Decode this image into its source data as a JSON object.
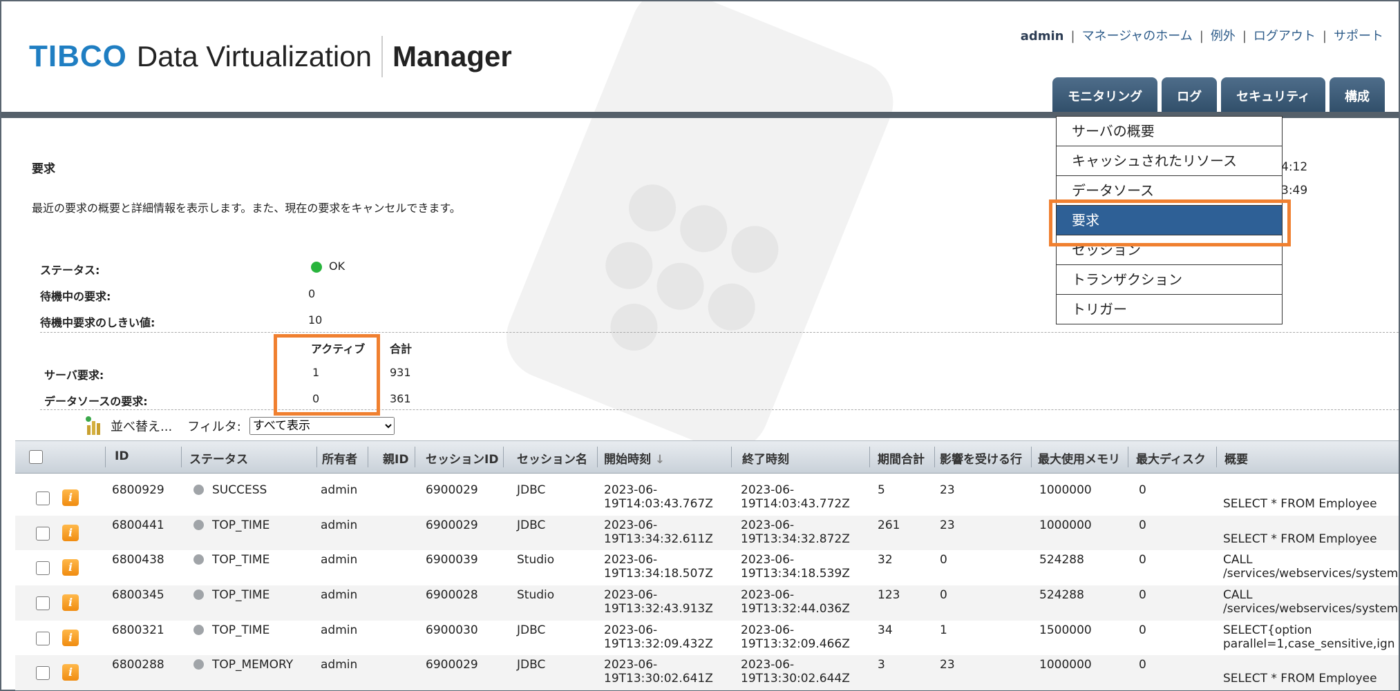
{
  "app": {
    "brand": "TIBCO",
    "product": "Data Virtualization",
    "module": "Manager"
  },
  "top_links": {
    "user": "admin",
    "home": "マネージャのホーム",
    "exceptions": "例外",
    "logout": "ログアウト",
    "support": "サポート"
  },
  "tabs": [
    "モニタリング",
    "ログ",
    "セキュリティ",
    "構成"
  ],
  "menu": {
    "items": [
      "サーバの概要",
      "キャッシュされたリソース",
      "データソース",
      "要求",
      "セッション",
      "トランザクション",
      "トリガー"
    ],
    "selected": "要求",
    "selected_index": 3
  },
  "peek_text": [
    "4:12",
    "3:49"
  ],
  "page": {
    "title": "要求",
    "description": "最近の要求の概要と詳細情報を表示します。また、現在の要求をキャンセルできます。"
  },
  "status": {
    "status_label": "ステータス:",
    "status_value": "OK",
    "pending_label": "待機中の要求:",
    "pending_value": "0",
    "threshold_label": "待機中要求のしきい値:",
    "threshold_value": "10",
    "col_active": "アクティブ",
    "col_total": "合計",
    "server_label": "サーバ要求:",
    "server_active": "1",
    "server_total": "931",
    "ds_label": "データソースの要求:",
    "ds_active": "0",
    "ds_total": "361"
  },
  "toolbar": {
    "sort_label": "並べ替え...",
    "filter_label": "フィルタ:",
    "filter_value": "すべて表示"
  },
  "table": {
    "headers": [
      "ID",
      "ステータス",
      "所有者",
      "親ID",
      "セッションID",
      "セッション名",
      "開始時刻",
      "終了時刻",
      "期間合計",
      "影響を受ける行",
      "最大使用メモリ",
      "最大ディスク",
      "概要"
    ],
    "sort_indicator": "↓",
    "rows": [
      {
        "id": "6800929",
        "status": "SUCCESS",
        "owner": "admin",
        "session_id": "6900029",
        "session_name": "JDBC",
        "start": [
          "2023-06-",
          "19T14:03:43.767Z"
        ],
        "end": [
          "2023-06-",
          "19T14:03:43.772Z"
        ],
        "duration": "5",
        "rows": "23",
        "mem": "1000000",
        "disk": "0",
        "summary": [
          "",
          "SELECT * FROM Employee"
        ]
      },
      {
        "id": "6800441",
        "status": "TOP_TIME",
        "owner": "admin",
        "session_id": "6900029",
        "session_name": "JDBC",
        "start": [
          "2023-06-",
          "19T13:34:32.611Z"
        ],
        "end": [
          "2023-06-",
          "19T13:34:32.872Z"
        ],
        "duration": "261",
        "rows": "23",
        "mem": "1000000",
        "disk": "0",
        "summary": [
          "",
          "SELECT * FROM Employee"
        ]
      },
      {
        "id": "6800438",
        "status": "TOP_TIME",
        "owner": "admin",
        "session_id": "6900039",
        "session_name": "Studio",
        "start": [
          "2023-06-",
          "19T13:34:18.507Z"
        ],
        "end": [
          "2023-06-",
          "19T13:34:18.539Z"
        ],
        "duration": "32",
        "rows": "0",
        "mem": "524288",
        "disk": "0",
        "summary": [
          "CALL",
          "/services/webservices/system"
        ]
      },
      {
        "id": "6800345",
        "status": "TOP_TIME",
        "owner": "admin",
        "session_id": "6900028",
        "session_name": "Studio",
        "start": [
          "2023-06-",
          "19T13:32:43.913Z"
        ],
        "end": [
          "2023-06-",
          "19T13:32:44.036Z"
        ],
        "duration": "123",
        "rows": "0",
        "mem": "524288",
        "disk": "0",
        "summary": [
          "CALL",
          "/services/webservices/system"
        ]
      },
      {
        "id": "6800321",
        "status": "TOP_TIME",
        "owner": "admin",
        "session_id": "6900030",
        "session_name": "JDBC",
        "start": [
          "2023-06-",
          "19T13:32:09.432Z"
        ],
        "end": [
          "2023-06-",
          "19T13:32:09.466Z"
        ],
        "duration": "34",
        "rows": "1",
        "mem": "1500000",
        "disk": "0",
        "summary": [
          "SELECT{option",
          "parallel=1,case_sensitive,ign"
        ]
      },
      {
        "id": "6800288",
        "status": "TOP_MEMORY",
        "owner": "admin",
        "session_id": "6900029",
        "session_name": "JDBC",
        "start": [
          "2023-06-",
          "19T13:30:02.641Z"
        ],
        "end": [
          "2023-06-",
          "19T13:30:02.644Z"
        ],
        "duration": "3",
        "rows": "23",
        "mem": "1000000",
        "disk": "0",
        "summary": [
          "",
          "SELECT * FROM Employee"
        ]
      }
    ]
  },
  "colors": {
    "accent": "#2e6096",
    "highlight": "#f08030",
    "ok": "#28b43c",
    "tab": "#3b5a76"
  }
}
